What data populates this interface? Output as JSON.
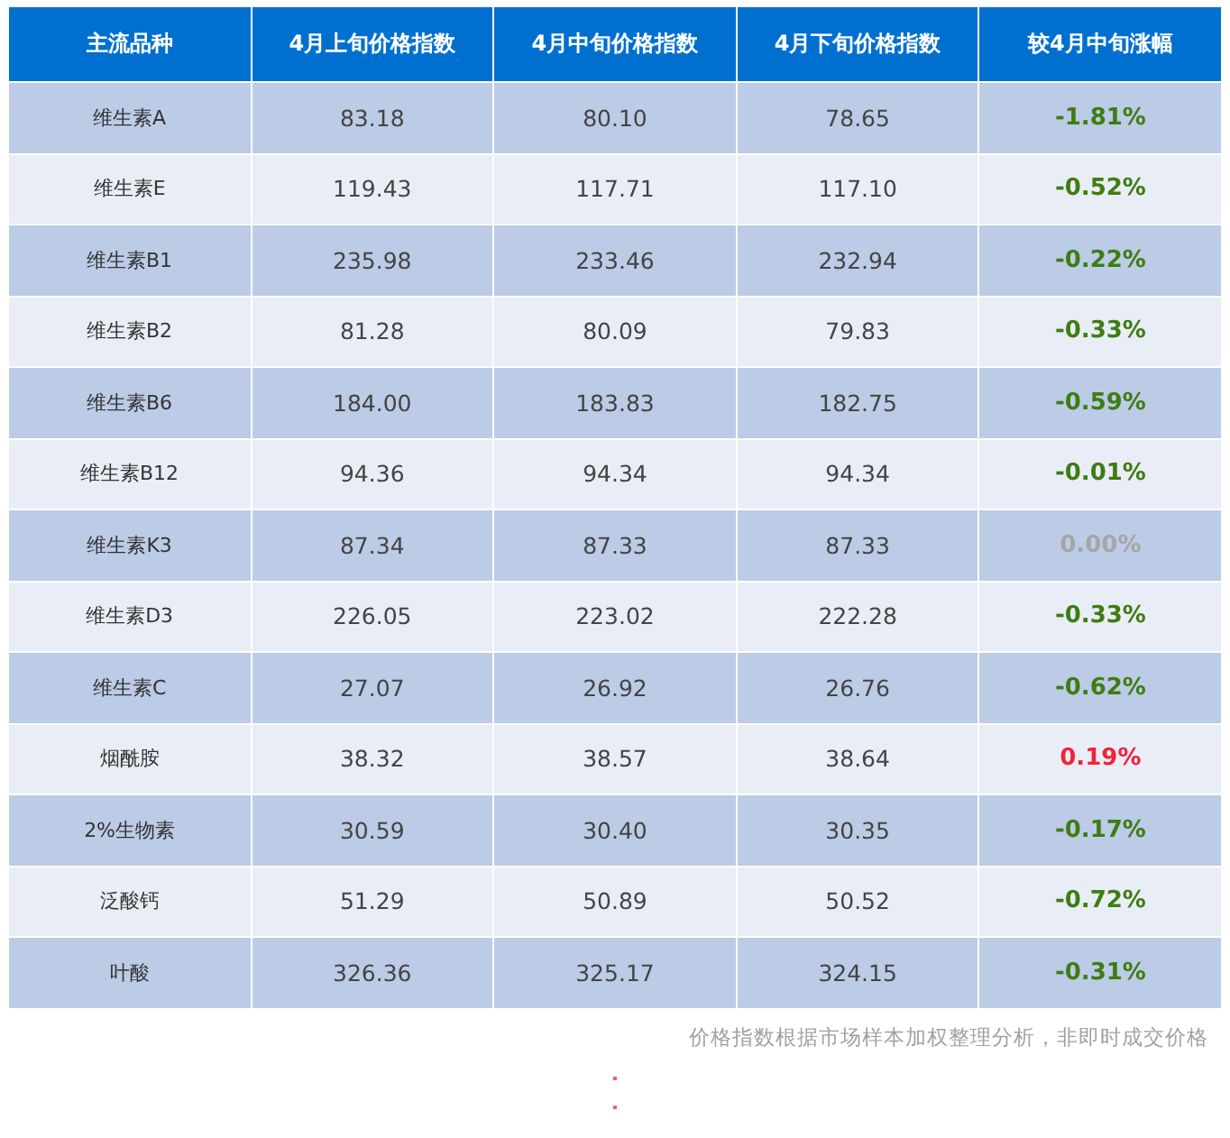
{
  "table": {
    "columns": [
      "主流品种",
      "4月上旬价格指数",
      "4月中旬价格指数",
      "4月下旬价格指数",
      "较4月中旬涨幅"
    ],
    "rows": [
      {
        "name": "维生素A",
        "early": "83.18",
        "mid": "80.10",
        "late": "78.65",
        "change": "-1.81%",
        "color": "#3e7d12"
      },
      {
        "name": "维生素E",
        "early": "119.43",
        "mid": "117.71",
        "late": "117.10",
        "change": "-0.52%",
        "color": "#3e7d12"
      },
      {
        "name": "维生素B1",
        "early": "235.98",
        "mid": "233.46",
        "late": "232.94",
        "change": "-0.22%",
        "color": "#3e7d12"
      },
      {
        "name": "维生素B2",
        "early": "81.28",
        "mid": "80.09",
        "late": "79.83",
        "change": "-0.33%",
        "color": "#3e7d12"
      },
      {
        "name": "维生素B6",
        "early": "184.00",
        "mid": "183.83",
        "late": "182.75",
        "change": "-0.59%",
        "color": "#3e7d12"
      },
      {
        "name": "维生素B12",
        "early": "94.36",
        "mid": "94.34",
        "late": "94.34",
        "change": "-0.01%",
        "color": "#3e7d12"
      },
      {
        "name": "维生素K3",
        "early": "87.34",
        "mid": "87.33",
        "late": "87.33",
        "change": "0.00%",
        "color": "#a6a6a6"
      },
      {
        "name": "维生素D3",
        "early": "226.05",
        "mid": "223.02",
        "late": "222.28",
        "change": "-0.33%",
        "color": "#3e7d12"
      },
      {
        "name": "维生素C",
        "early": "27.07",
        "mid": "26.92",
        "late": "26.76",
        "change": "-0.62%",
        "color": "#3e7d12"
      },
      {
        "name": "烟酰胺",
        "early": "38.32",
        "mid": "38.57",
        "late": "38.64",
        "change": "0.19%",
        "color": "#f0233a"
      },
      {
        "name": "2%生物素",
        "early": "30.59",
        "mid": "30.40",
        "late": "30.35",
        "change": "-0.17%",
        "color": "#3e7d12"
      },
      {
        "name": "泛酸钙",
        "early": "51.29",
        "mid": "50.89",
        "late": "50.52",
        "change": "-0.72%",
        "color": "#3e7d12"
      },
      {
        "name": "叶酸",
        "early": "326.36",
        "mid": "325.17",
        "late": "324.15",
        "change": "-0.31%",
        "color": "#3e7d12"
      }
    ]
  },
  "footnote": "价格指数根据市场样本加权整理分析，非即时成交价格"
}
